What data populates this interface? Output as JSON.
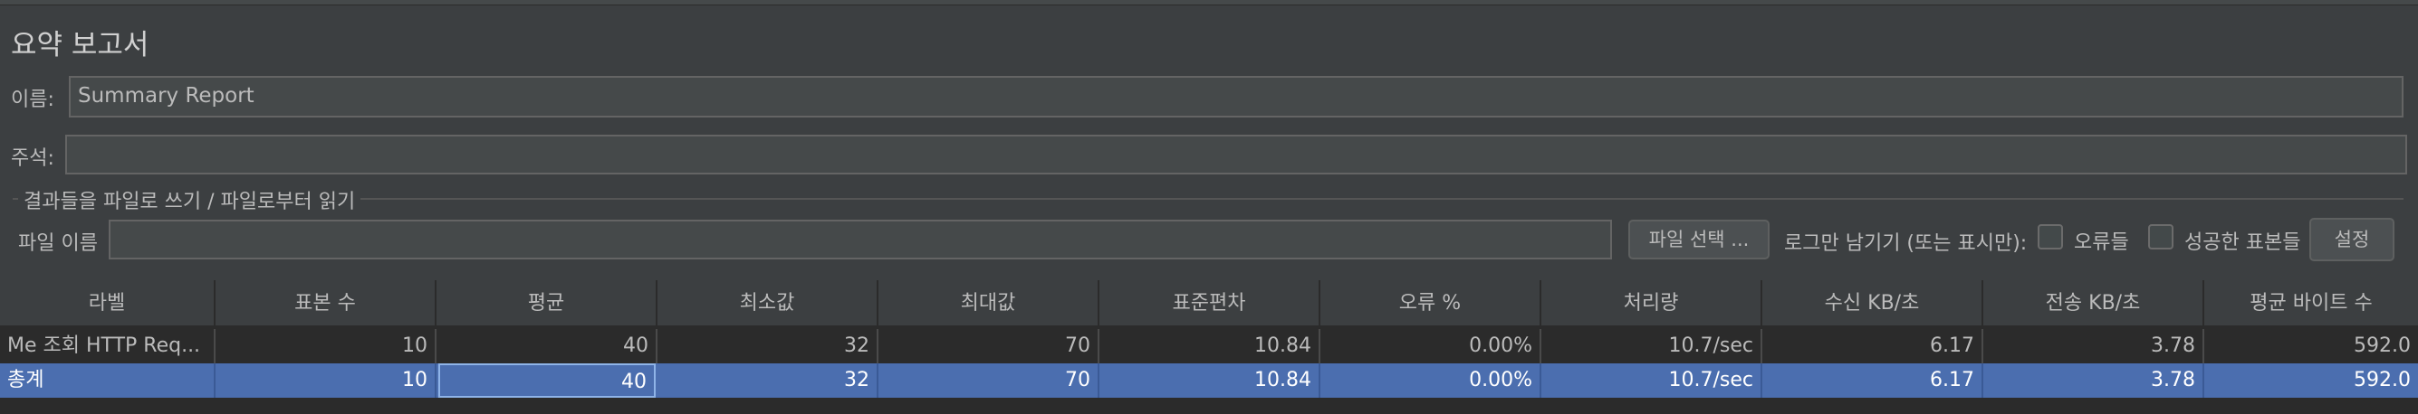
{
  "title": "요약 보고서",
  "name_label": "이름:",
  "name_value": "Summary Report",
  "comment_label": "주석:",
  "comment_value": "",
  "group_title": "결과들을 파일로 쓰기 / 파일로부터 읽기",
  "file": {
    "label": "파일 이름",
    "value": "",
    "browse": "파일 선택 ...",
    "log_only": "로그만 남기기 (또는 표시만):",
    "errors": "오류들",
    "success": "성공한 표본들",
    "configure": "설정"
  },
  "table": {
    "headers": [
      "라벨",
      "표본 수",
      "평균",
      "최소값",
      "최대값",
      "표준편차",
      "오류 %",
      "처리량",
      "수신 KB/초",
      "전송 KB/초",
      "평균 바이트 수"
    ],
    "rows": [
      [
        "Me 조회 HTTP Req...",
        "10",
        "40",
        "32",
        "70",
        "10.84",
        "0.00%",
        "10.7/sec",
        "6.17",
        "3.78",
        "592.0"
      ],
      [
        "총계",
        "10",
        "40",
        "32",
        "70",
        "10.84",
        "0.00%",
        "10.7/sec",
        "6.17",
        "3.78",
        "592.0"
      ]
    ]
  }
}
